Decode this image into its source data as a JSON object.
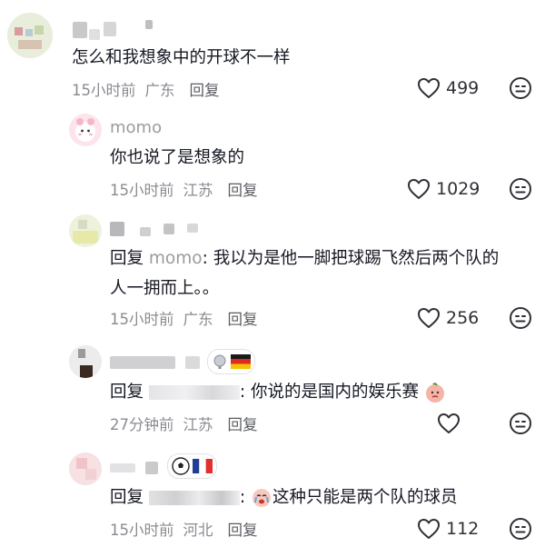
{
  "comments": [
    {
      "username": "",
      "text": "怎么和我想象中的开球不一样",
      "time": "15小时前",
      "location": "广东",
      "reply_label": "回复",
      "likes": "499"
    },
    {
      "username": "momo",
      "text": "你也说了是想象的",
      "time": "15小时前",
      "location": "江苏",
      "reply_label": "回复",
      "likes": "1029"
    },
    {
      "username": "",
      "reply_prefix": "回复",
      "mention": "momo",
      "text_line1": ": 我以为是他一脚把球踢飞然后两个队的",
      "text_line2": "人一拥而上。。",
      "time": "15小时前",
      "location": "广东",
      "reply_label": "回复",
      "likes": "256"
    },
    {
      "username": "",
      "reply_prefix": "回复",
      "text": ": 你说的是国内的娱乐赛",
      "time": "27分钟前",
      "location": "江苏",
      "reply_label": "回复",
      "likes": ""
    },
    {
      "username": "",
      "reply_prefix": "回复",
      "text": "这种只能是两个队的球员",
      "time": "15小时前",
      "location": "河北",
      "reply_label": "回复",
      "likes": "112"
    }
  ],
  "colors": {
    "text": "#161823",
    "muted": "#8a8b91",
    "username": "#9a9ba0",
    "icon": "#2f3036"
  },
  "icons": {
    "like": "heart-outline-icon",
    "emoji": "neutral-face-icon"
  }
}
